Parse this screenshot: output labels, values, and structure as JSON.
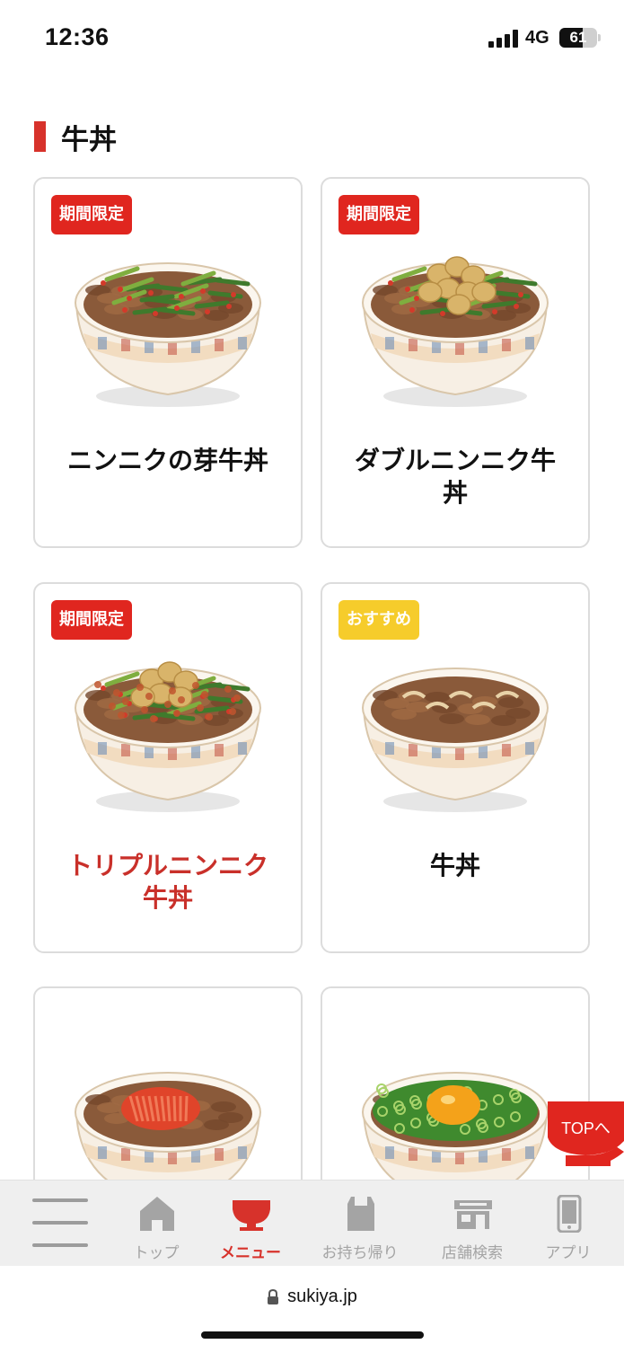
{
  "status_bar": {
    "time": "12:36",
    "network": "4G",
    "battery": "61",
    "battery_level": 0.61
  },
  "section": {
    "title": "牛丼",
    "accent_color": "#d7322b"
  },
  "cards": [
    {
      "badge": "期間限定",
      "badge_color": "red",
      "name_line1": "ニンニクの芽牛丼",
      "name_line2": "",
      "topping": "garlic-sprouts",
      "active": false
    },
    {
      "badge": "期間限定",
      "badge_color": "red",
      "name_line1": "ダブルニンニク牛",
      "name_line2": "丼",
      "topping": "garlic-cloves",
      "active": false
    },
    {
      "badge": "期間限定",
      "badge_color": "red",
      "name_line1": "トリプルニンニク",
      "name_line2": "牛丼",
      "topping": "triple-garlic",
      "active": true
    },
    {
      "badge": "おすすめ",
      "badge_color": "yellow",
      "name_line1": "牛丼",
      "name_line2": "",
      "topping": "plain-beef",
      "active": false
    },
    {
      "badge": "",
      "badge_color": "",
      "name_line1": "",
      "name_line2": "",
      "topping": "kimchi",
      "active": false
    },
    {
      "badge": "",
      "badge_color": "",
      "name_line1": "",
      "name_line2": "",
      "topping": "green-onion-egg",
      "active": false
    }
  ],
  "top_button": {
    "label": "TOPへ"
  },
  "bottom_nav": {
    "menu_icon": "hamburger-icon",
    "items": [
      {
        "label": "トップ",
        "icon": "home-icon",
        "active": false
      },
      {
        "label": "メニュー",
        "icon": "bowl-icon",
        "active": true
      },
      {
        "label": "お持ち帰り",
        "icon": "bag-icon",
        "active": false
      },
      {
        "label": "店舗検索",
        "icon": "store-icon",
        "active": false
      },
      {
        "label": "アプリ",
        "icon": "phone-icon",
        "active": false
      }
    ]
  },
  "address_bar": {
    "url": "sukiya.jp"
  },
  "colors": {
    "brand_red": "#d7322b",
    "badge_red": "#e0261f",
    "badge_yellow": "#f6cc2b",
    "nav_inactive": "#a4a4a4"
  }
}
